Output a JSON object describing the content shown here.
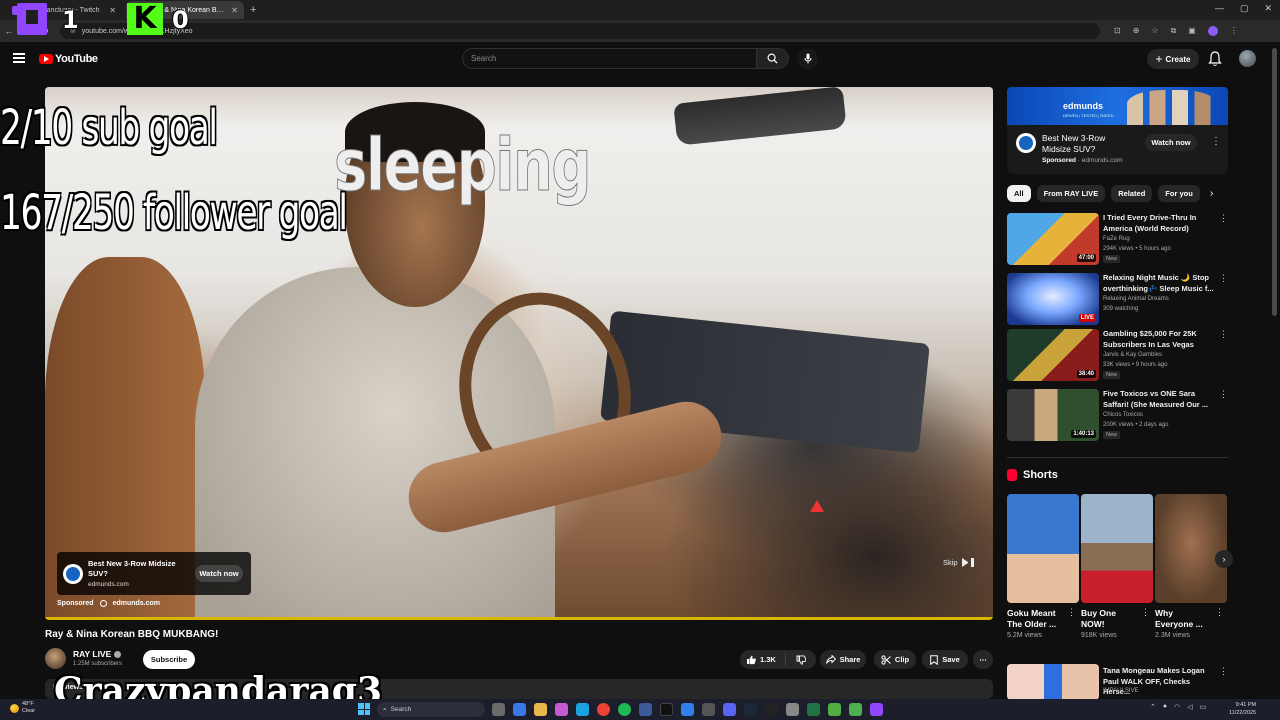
{
  "browser": {
    "tabs": [
      {
        "label": "veubsanctuary - Twitch",
        "active": false
      },
      {
        "label": "Ray & Nina Korean BBQ M…",
        "active": true
      }
    ],
    "url": "youtube.com/watch?v=...CHzjtyXeo"
  },
  "overlay": {
    "twitch_count": "1",
    "kick_letter": "K",
    "kick_count": "0",
    "sub_goal": "2/10 sub goal",
    "follower_goal": "167/250 follower goal",
    "status": "sleeping",
    "streamer_name": "Crazypandarag3"
  },
  "masthead": {
    "logo_text": "YouTube",
    "search_placeholder": "Search",
    "create_label": "Create"
  },
  "player": {
    "ad": {
      "title": "Best New 3-Row Midsize SUV?",
      "domain": "edmunds.com",
      "cta": "Watch now",
      "sponsored_label": "Sponsored",
      "sponsored_domain": "edmunds.com"
    },
    "skip_label": "Skip",
    "progress": 1.0
  },
  "video": {
    "title": "Ray & Nina Korean BBQ MUKBANG!",
    "channel": "RAY LIVE",
    "subscribers": "1.25M subscribers",
    "subscribe_label": "Subscribe",
    "likes": "1.3K",
    "share_label": "Share",
    "clip_label": "Clip",
    "save_label": "Save",
    "description_preview": "5K views"
  },
  "sidebar": {
    "sponsor": {
      "brand": "edmunds",
      "tagline": "DRIVEN | TESTED | RATED",
      "title": "Best New 3-Row Midsize SUV?",
      "sponsored": "Sponsored",
      "domain": "edmunds.com",
      "cta": "Watch now"
    },
    "chips": [
      "All",
      "From RAY LIVE",
      "Related",
      "For you"
    ],
    "recommendations": [
      {
        "title": "I Tried Every Drive-Thru In America (World Record)",
        "channel": "FaZe Rug",
        "meta": "294K views • 5 hours ago",
        "badge": "New",
        "duration": "47:00"
      },
      {
        "title": "Relaxing Night Music 🌙 Stop overthinking💤 Sleep Music f...",
        "channel": "Relaxing Animal Dreams",
        "meta": "309 watching",
        "badge": "",
        "duration": "LIVE"
      },
      {
        "title": "Gambling $25,000 For 25K Subscribers In Las Vegas",
        "channel": "Jarvis & Kay Gambles",
        "meta": "33K views • 9 hours ago",
        "badge": "New",
        "duration": "38:40"
      },
      {
        "title": "Five Toxicos vs ONE Sara Saffari! (She Measured Our ...",
        "channel": "Chicos Toxicos",
        "meta": "200K views • 2 days ago",
        "badge": "New",
        "duration": "1:40:13"
      }
    ],
    "shorts_heading": "Shorts",
    "shorts": [
      {
        "title": "Goku Meant The Older ...",
        "views": "5.2M views"
      },
      {
        "title": "Buy One NOW!",
        "views": "918K views"
      },
      {
        "title": "Why Everyone ...",
        "views": "2.3M views"
      }
    ],
    "more_rec": {
      "title": "Tana Mongeau Makes Logan Paul WALK OFF, Checks Herse...",
      "channel": "IMPAULSIVE"
    }
  },
  "taskbar": {
    "weather_temp": "48°F",
    "weather_text": "Clear",
    "search_label": "Search",
    "time": "9:41 PM",
    "date": "11/22/2025"
  }
}
